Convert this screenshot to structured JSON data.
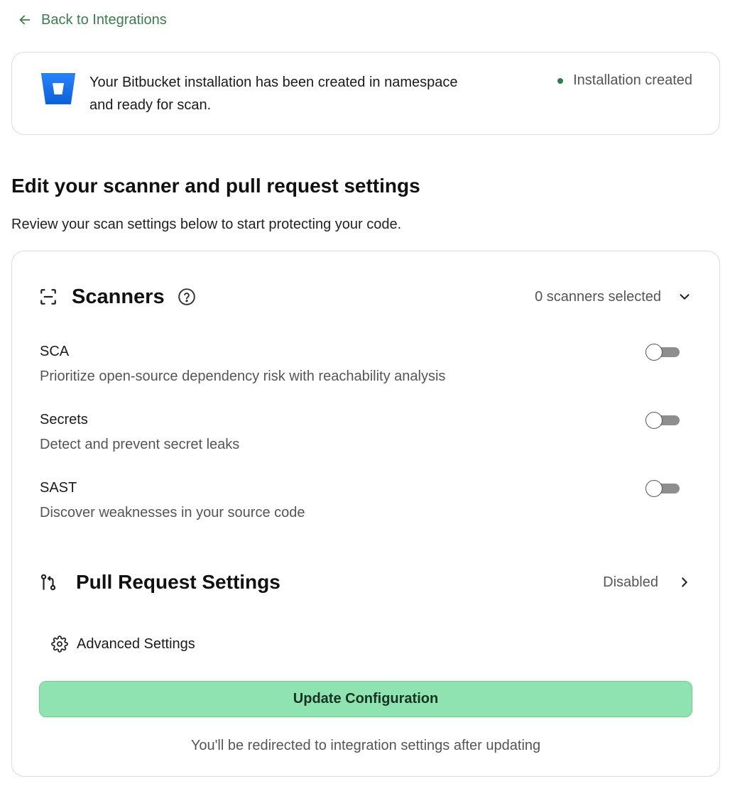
{
  "back_link": {
    "label": "Back to Integrations"
  },
  "installation": {
    "message": "Your Bitbucket installation has been created in namespace and ready for scan.",
    "status": "Installation created",
    "status_color": "#2f7d4a",
    "logo_icon": "bitbucket-logo"
  },
  "settings": {
    "title": "Edit your scanner and pull request settings",
    "subtitle": "Review your scan settings below to start protecting your code."
  },
  "scanners": {
    "title": "Scanners",
    "count_label": "0 scanners selected",
    "items": [
      {
        "name": "SCA",
        "description": "Prioritize open-source dependency risk with reachability analysis",
        "enabled": false
      },
      {
        "name": "Secrets",
        "description": "Detect and prevent secret leaks",
        "enabled": false
      },
      {
        "name": "SAST",
        "description": "Discover weaknesses in your source code",
        "enabled": false
      }
    ]
  },
  "pull_request": {
    "title": "Pull Request Settings",
    "status": "Disabled"
  },
  "advanced": {
    "label": "Advanced Settings"
  },
  "actions": {
    "update_label": "Update Configuration",
    "redirect_note": "You'll be redirected to integration settings after updating",
    "button_color": "#8fe3b0"
  }
}
